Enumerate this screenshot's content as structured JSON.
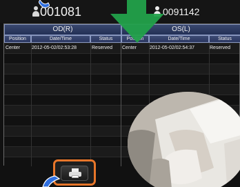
{
  "header": {
    "od_patient_id": "001081",
    "os_patient_id": "0091142"
  },
  "table": {
    "od_label": "OD(R)",
    "os_label": "OS(L)",
    "columns": [
      "Position",
      "Date/Time",
      "Status",
      "Position",
      "Date/Time",
      "Status"
    ],
    "rows": [
      {
        "od_position": "Center",
        "od_datetime": "2012-05-02/02:53:28",
        "od_status": "Reserved",
        "os_position": "Center",
        "os_datetime": "2012-05-02/02:54:37",
        "os_status": "Reserved"
      }
    ]
  },
  "colors": {
    "header_blue": "#2c3a63",
    "print_button_border": "#e8762a",
    "arrow_green": "#22a14a",
    "pointer_blue": "#2f6fe0"
  },
  "icons": [
    "person-icon",
    "printer-icon",
    "arrow-down-icon"
  ]
}
